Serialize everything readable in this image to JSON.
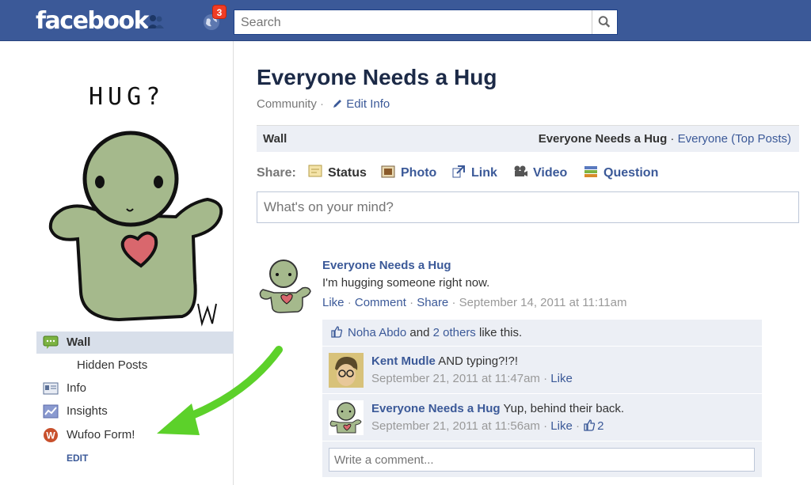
{
  "topbar": {
    "logo": "facebook",
    "notifications_count": "3",
    "search_placeholder": "Search"
  },
  "profile": {
    "image_caption": "HUG?",
    "image_signature": "W"
  },
  "sidebar": {
    "items": [
      {
        "label": "Wall"
      },
      {
        "label": "Hidden Posts"
      },
      {
        "label": "Info"
      },
      {
        "label": "Insights"
      },
      {
        "label": "Wufoo Form!"
      }
    ],
    "edit_label": "EDIT"
  },
  "page": {
    "title": "Everyone Needs a Hug",
    "category": "Community",
    "separator": "·",
    "edit_info": "Edit Info"
  },
  "wall_bar": {
    "left": "Wall",
    "right_name": "Everyone Needs a Hug",
    "right_sep": "·",
    "right_filter": "Everyone (Top Posts)"
  },
  "share": {
    "label": "Share:",
    "options": [
      {
        "label": "Status"
      },
      {
        "label": "Photo"
      },
      {
        "label": "Link"
      },
      {
        "label": "Video"
      },
      {
        "label": "Question"
      }
    ],
    "placeholder": "What's on your mind?"
  },
  "post": {
    "author": "Everyone Needs a Hug",
    "text": "I'm hugging someone right now.",
    "like": "Like",
    "comment": "Comment",
    "share": "Share",
    "sep": "·",
    "timestamp": "September 14, 2011 at 11:11am"
  },
  "likes": {
    "name": "Noha Abdo",
    "and": "and",
    "others": "2 others",
    "suffix": "like this."
  },
  "comments": [
    {
      "author": "Kent Mudle",
      "text": "AND typing?!?!",
      "time": "September 21, 2011 at 11:47am",
      "like": "Like"
    },
    {
      "author": "Everyone Needs a Hug",
      "text": "Yup, behind their back.",
      "time": "September 21, 2011 at 11:56am",
      "like": "Like",
      "like_count": "2"
    }
  ],
  "write_comment_placeholder": "Write a comment...",
  "colors": {
    "brand": "#3b5998",
    "arrow": "#5cd12a",
    "character": "#a5b98c"
  }
}
